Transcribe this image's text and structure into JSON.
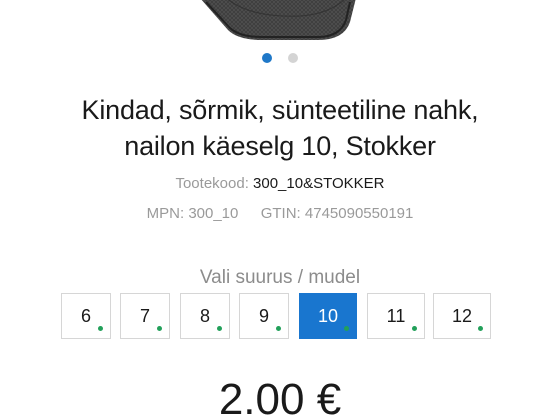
{
  "carousel": {
    "slide_count": 2,
    "active_slide": 1
  },
  "product": {
    "title_line1": "Kindad, sõrmik, sünteetiline nahk,",
    "title_line2": "nailon käeselg 10, Stokker",
    "sku_label": "Tootekood:",
    "sku_value": "300_10&STOKKER",
    "mpn_label": "MPN:",
    "mpn_value": "300_10",
    "gtin_label": "GTIN:",
    "gtin_value": "4745090550191"
  },
  "sizes": {
    "label": "Vali suurus / mudel",
    "selected": "10",
    "options": [
      {
        "label": "6",
        "in_stock": true
      },
      {
        "label": "7",
        "in_stock": true
      },
      {
        "label": "8",
        "in_stock": true
      },
      {
        "label": "9",
        "in_stock": true
      },
      {
        "label": "10",
        "in_stock": true
      },
      {
        "label": "11",
        "in_stock": true
      },
      {
        "label": "12",
        "in_stock": true
      }
    ]
  },
  "price": {
    "value": "2.00 €"
  },
  "colors": {
    "accent": "#1976cf",
    "stock_dot": "#22a05a",
    "muted_text": "#9a9a9a"
  }
}
